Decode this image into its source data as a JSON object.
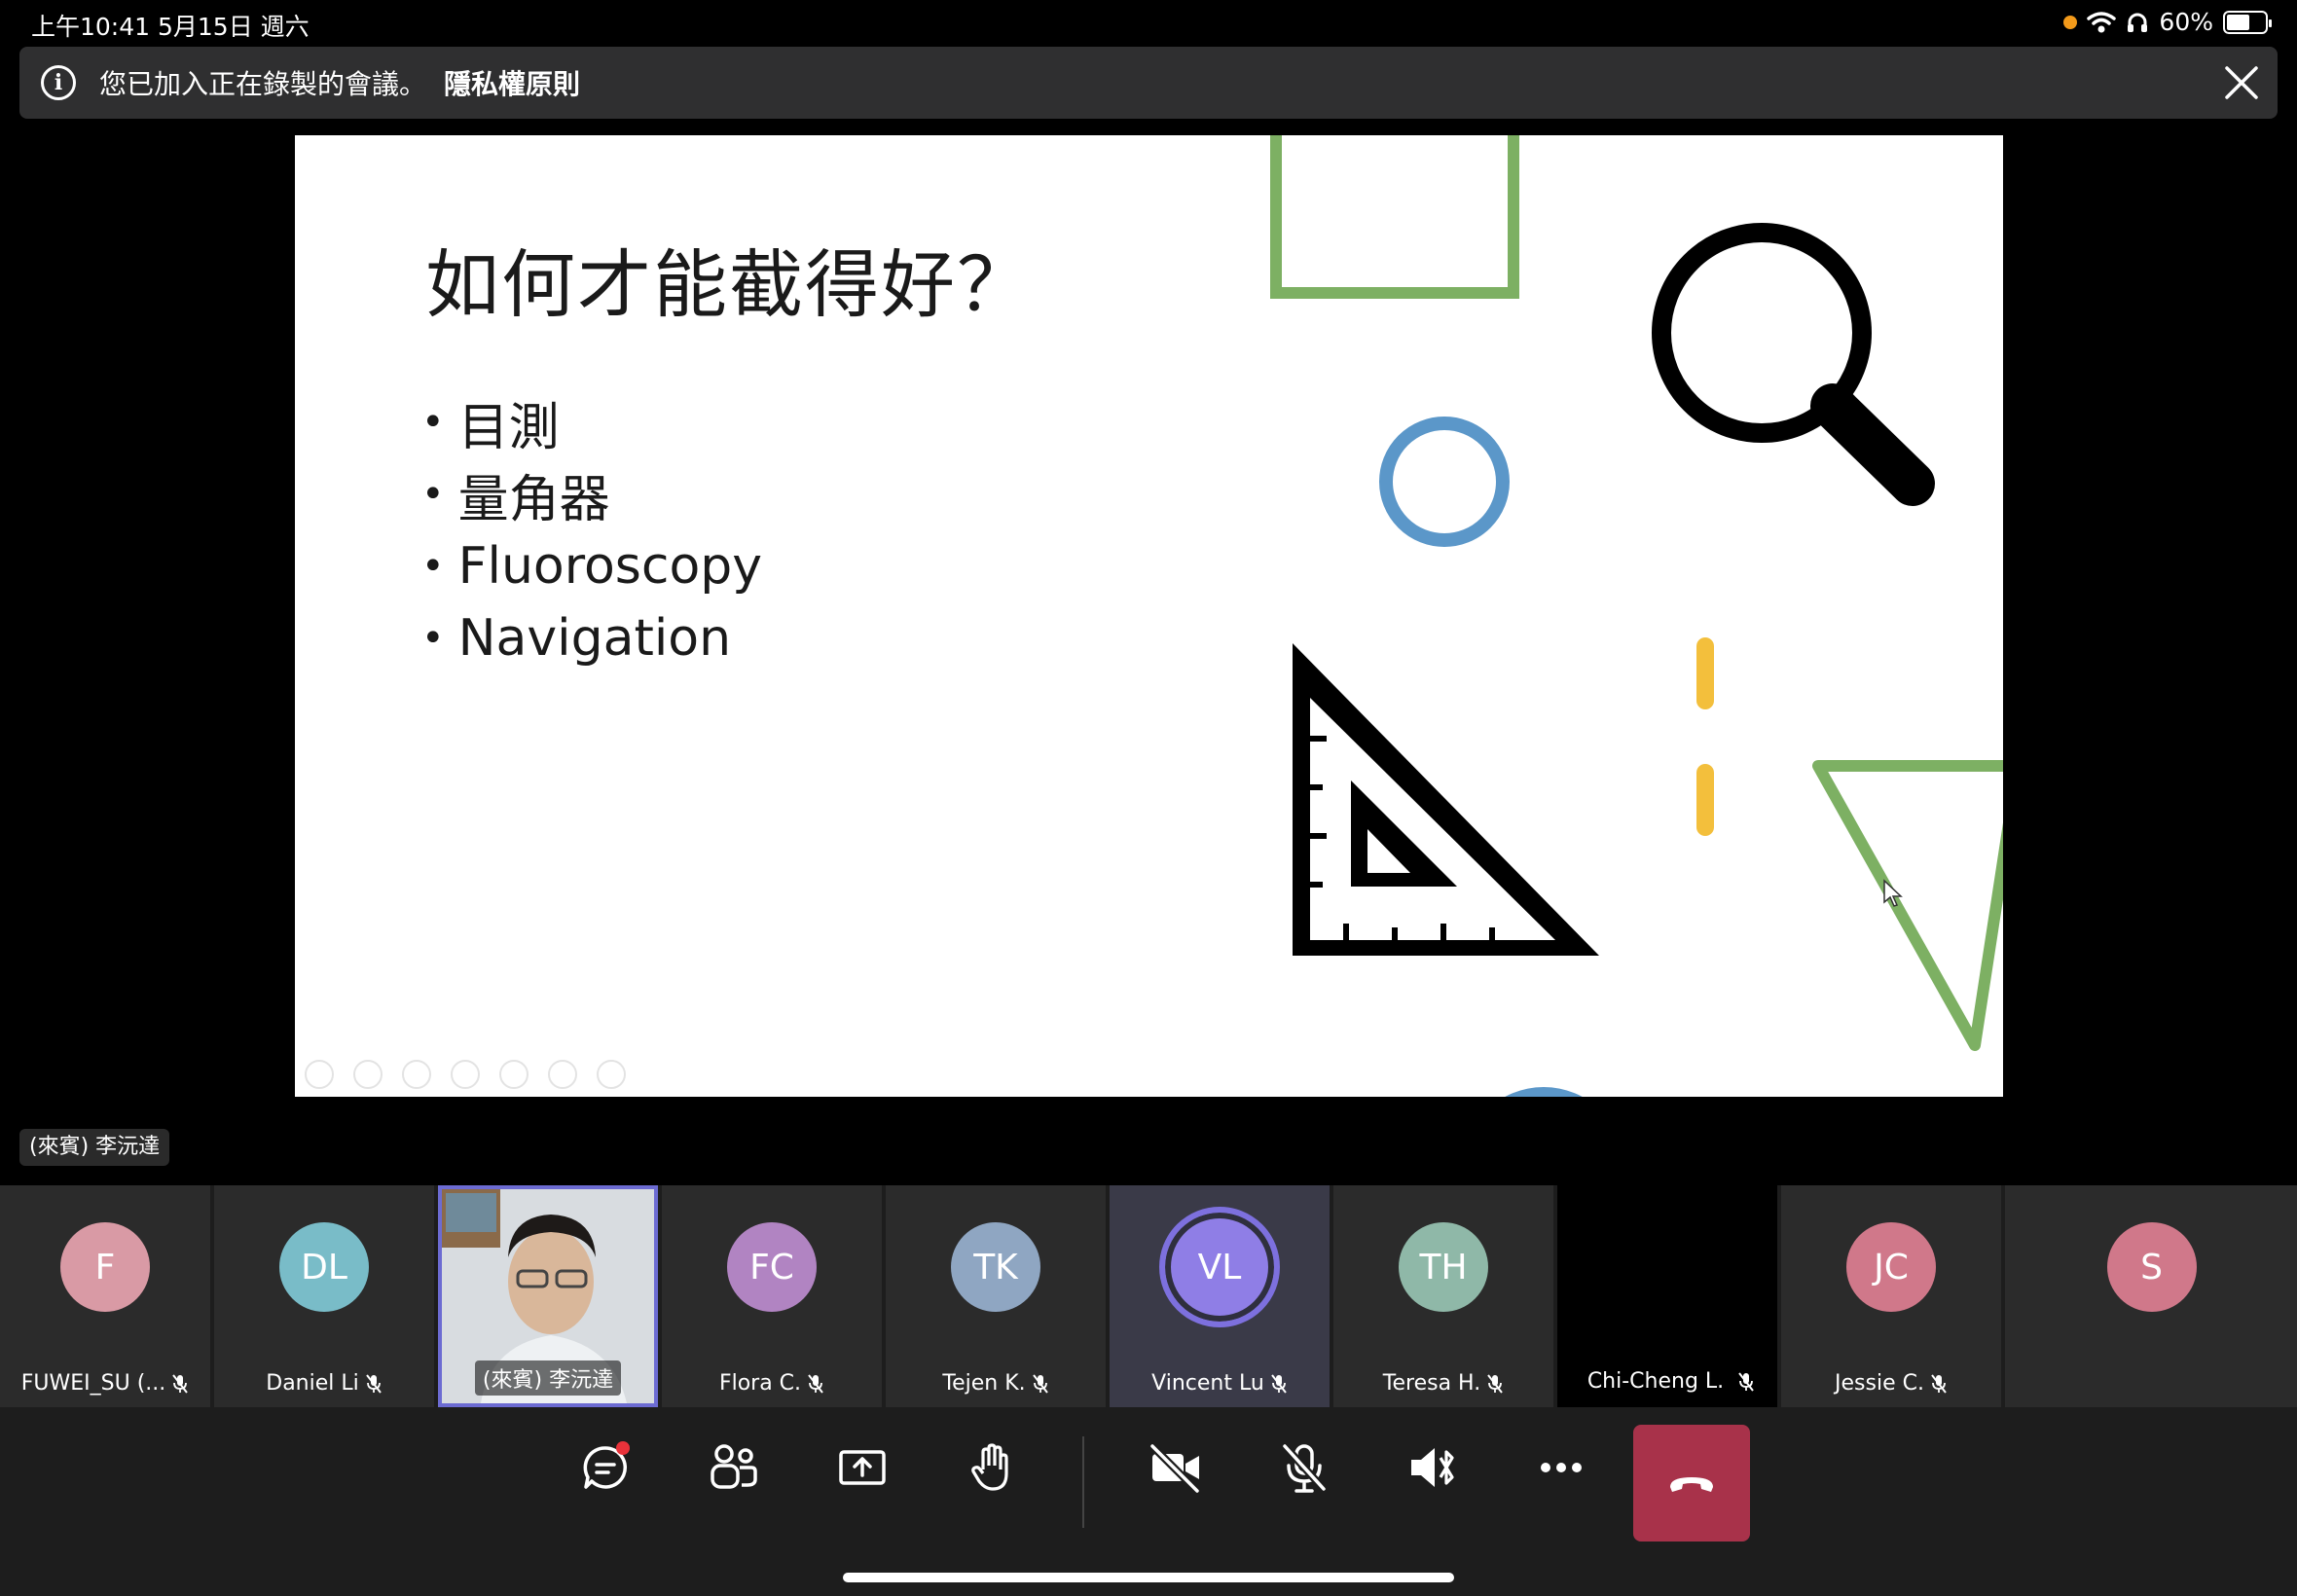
{
  "status_bar": {
    "time": "上午10:41  5月15日 週六",
    "battery": "60%",
    "battery_level": 0.6
  },
  "banner": {
    "message": "您已加入正在錄製的會議。",
    "link": "隱私權原則"
  },
  "slide": {
    "title": "如何才能截得好？",
    "bullets": [
      "目測",
      "量角器",
      "Fluoroscopy",
      "Navigation"
    ]
  },
  "presenter_label": "(來賓) 李沅達",
  "participants": [
    {
      "initials": "F",
      "name": "FUWEI_SU (...",
      "color": "#d99aa5",
      "muted": true
    },
    {
      "initials": "DL",
      "name": "Daniel Li",
      "color": "#79bcc8",
      "muted": true
    },
    {
      "initials": "",
      "name": "(來賓) 李沅達",
      "color": "",
      "muted": false
    },
    {
      "initials": "FC",
      "name": "Flora C.",
      "color": "#b184c2",
      "muted": true
    },
    {
      "initials": "TK",
      "name": "Tejen K.",
      "color": "#8fa6c2",
      "muted": true
    },
    {
      "initials": "VL",
      "name": "Vincent Lu",
      "color": "#8f7ee6",
      "muted": true
    },
    {
      "initials": "TH",
      "name": "Teresa H.",
      "color": "#8fb8a8",
      "muted": true
    },
    {
      "initials": "",
      "name": "Chi-Cheng L.",
      "color": "#000000",
      "muted": true
    },
    {
      "initials": "JC",
      "name": "Jessie C.",
      "color": "#d0788a",
      "muted": true
    },
    {
      "initials": "S",
      "name": "",
      "color": "#d0788a",
      "muted": false
    }
  ],
  "controls": [
    "chat",
    "people",
    "share",
    "raise-hand",
    "camera-off",
    "mic-off",
    "speaker",
    "more",
    "hang-up"
  ],
  "colors": {
    "hangup": "#a8324a",
    "accent": "#6c6bd2",
    "green": "#7db063",
    "blue": "#5b97c9",
    "yellow": "#f3bf3c"
  }
}
